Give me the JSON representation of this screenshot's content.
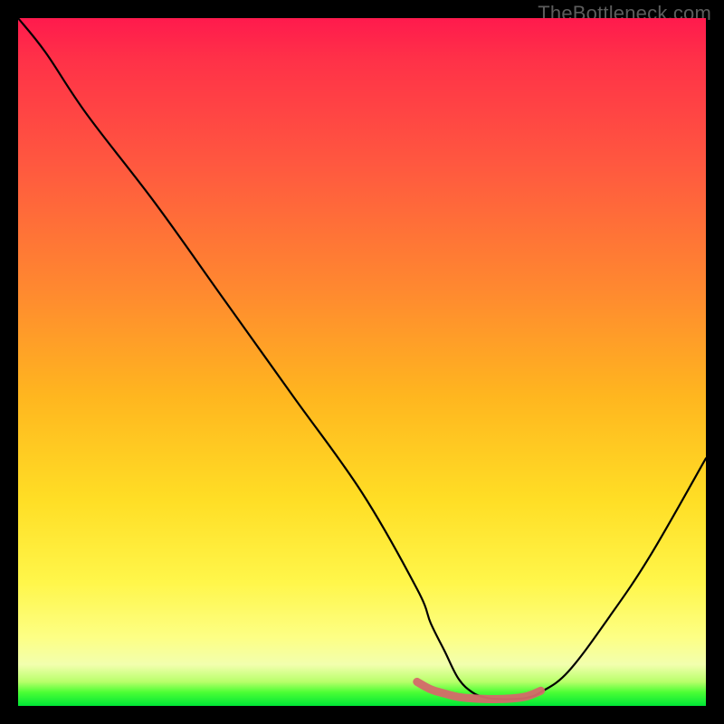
{
  "watermark": "TheBottleneck.com",
  "chart_data": {
    "type": "line",
    "title": "",
    "xlabel": "",
    "ylabel": "",
    "xlim": [
      0,
      100
    ],
    "ylim": [
      0,
      100
    ],
    "grid": false,
    "legend": false,
    "series": [
      {
        "name": "main-curve",
        "color": "#000000",
        "x": [
          0,
          4,
          10,
          20,
          30,
          40,
          50,
          58,
          60,
          62,
          64,
          66,
          68,
          70,
          72,
          74,
          76,
          80,
          86,
          92,
          100
        ],
        "y": [
          100,
          95,
          86,
          73,
          59,
          45,
          31,
          17,
          12,
          8,
          4,
          2,
          1.2,
          1,
          1,
          1.2,
          2,
          5,
          13,
          22,
          36
        ]
      },
      {
        "name": "valley-highlight",
        "color": "#d46a6a",
        "x": [
          58,
          60,
          62,
          64,
          66,
          68,
          70,
          72,
          74,
          76
        ],
        "y": [
          3.5,
          2.4,
          1.8,
          1.3,
          1.1,
          1.0,
          1.0,
          1.1,
          1.4,
          2.2
        ]
      }
    ],
    "background_gradient": {
      "top": "#ff1a4d",
      "upper_mid": "#ff8a2f",
      "mid": "#ffde25",
      "lower": "#fdff84",
      "bottom": "#00e636"
    }
  }
}
